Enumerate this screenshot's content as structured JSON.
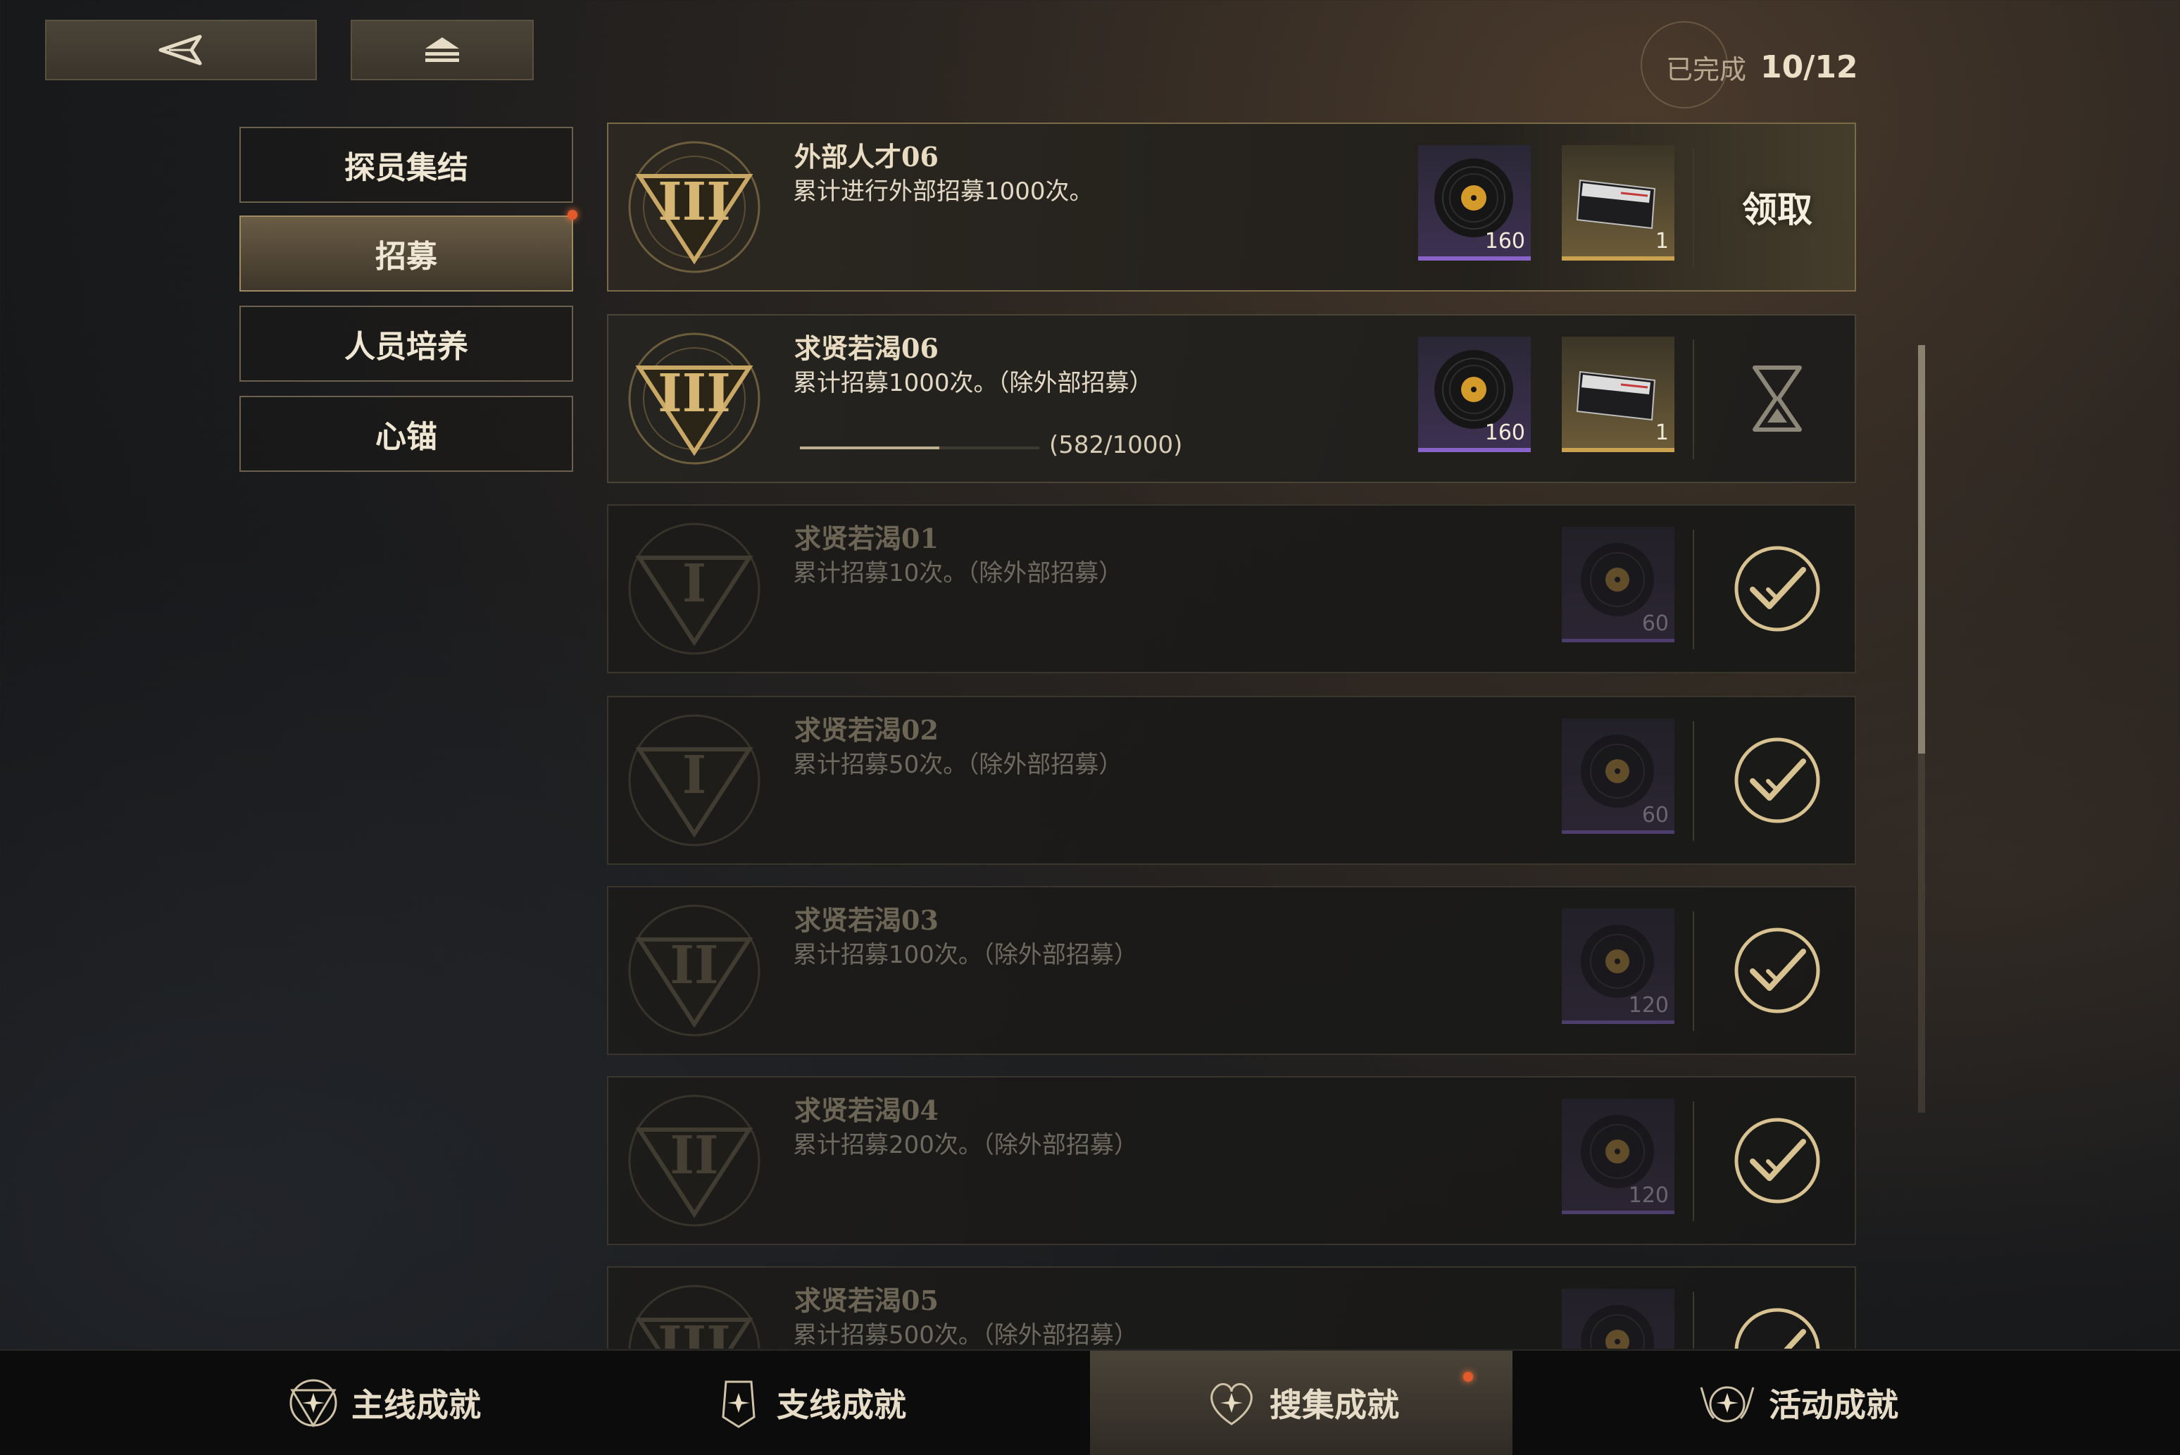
{
  "header": {
    "completed_label": "已完成",
    "completed_value": "10/12"
  },
  "sub_menu": [
    {
      "label": "探员集结"
    },
    {
      "label": "招募"
    },
    {
      "label": "人员培养"
    },
    {
      "label": "心锚"
    }
  ],
  "achievements": [
    {
      "title": "外部人才06",
      "desc": "累计进行外部招募1000次。",
      "tier": "III",
      "state": "claim",
      "rewards": [
        {
          "qty": "160",
          "icon": "record-icon"
        },
        {
          "qty": "1",
          "icon": "ticket-card-icon"
        }
      ],
      "action_label": "领取"
    },
    {
      "title": "求贤若渴06",
      "desc": "累计招募1000次。（除外部招募）",
      "tier": "III",
      "state": "in-progress",
      "progress_text": "(582/1000)",
      "progress_fraction": 0.582,
      "rewards": [
        {
          "qty": "160",
          "icon": "record-icon"
        },
        {
          "qty": "1",
          "icon": "ticket-card-icon"
        }
      ],
      "action_icon": "hourglass-icon"
    },
    {
      "title": "求贤若渴01",
      "desc": "累计招募10次。（除外部招募）",
      "tier": "I",
      "state": "done",
      "rewards": [
        {
          "qty": "60",
          "icon": "record-icon"
        }
      ],
      "action_icon": "checkmark-icon"
    },
    {
      "title": "求贤若渴02",
      "desc": "累计招募50次。（除外部招募）",
      "tier": "I",
      "state": "done",
      "rewards": [
        {
          "qty": "60",
          "icon": "record-icon"
        }
      ],
      "action_icon": "checkmark-icon"
    },
    {
      "title": "求贤若渴03",
      "desc": "累计招募100次。（除外部招募）",
      "tier": "II",
      "state": "done",
      "rewards": [
        {
          "qty": "120",
          "icon": "record-icon"
        }
      ],
      "action_icon": "checkmark-icon"
    },
    {
      "title": "求贤若渴04",
      "desc": "累计招募200次。（除外部招募）",
      "tier": "II",
      "state": "done",
      "rewards": [
        {
          "qty": "120",
          "icon": "record-icon"
        }
      ],
      "action_icon": "checkmark-icon"
    },
    {
      "title": "求贤若渴05",
      "desc": "累计招募500次。（除外部招募）",
      "tier": "III",
      "state": "done",
      "rewards": [
        {
          "qty": "",
          "icon": "record-icon"
        }
      ],
      "action_icon": "checkmark-icon"
    }
  ],
  "tabs": [
    {
      "label": "主线成就",
      "icon": "compass-star-icon"
    },
    {
      "label": "支线成就",
      "icon": "shield-star-icon"
    },
    {
      "label": "搜集成就",
      "icon": "heart-star-icon"
    },
    {
      "label": "活动成就",
      "icon": "winged-star-icon"
    }
  ],
  "colors": {
    "accent_gold": "#c9a14f",
    "rare_purple": "#8a63c8",
    "notify_red": "#e55a2a"
  }
}
